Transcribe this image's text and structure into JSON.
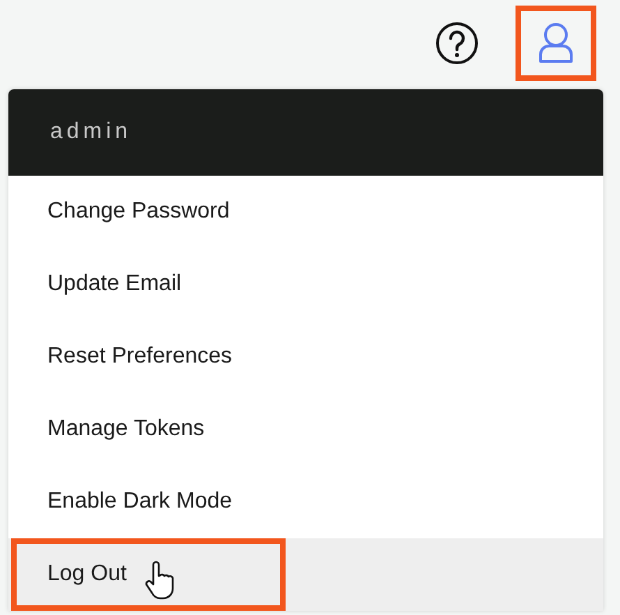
{
  "top_bar": {
    "user_button": {
      "highlighted": true
    }
  },
  "menu": {
    "title": "admin",
    "items": [
      {
        "label": "Change Password",
        "hovered": false,
        "highlighted": false
      },
      {
        "label": "Update Email",
        "hovered": false,
        "highlighted": false
      },
      {
        "label": "Reset Preferences",
        "hovered": false,
        "highlighted": false
      },
      {
        "label": "Manage Tokens",
        "hovered": false,
        "highlighted": false
      },
      {
        "label": "Enable Dark Mode",
        "hovered": false,
        "highlighted": false
      },
      {
        "label": "Log Out",
        "hovered": true,
        "highlighted": true
      }
    ]
  }
}
